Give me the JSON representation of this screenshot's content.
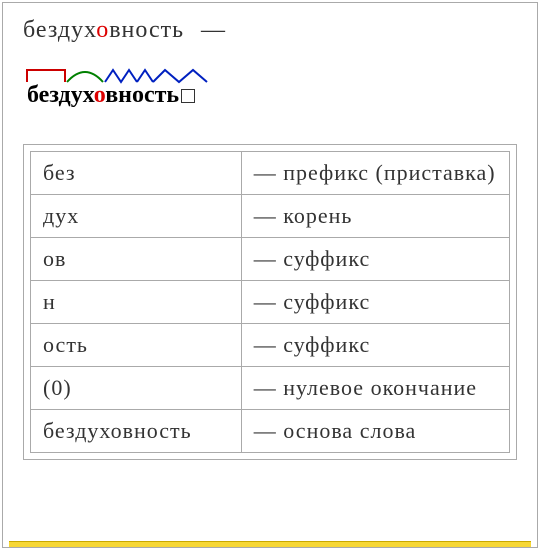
{
  "headword": {
    "pre": "бездух",
    "stress": "о",
    "post": "вность",
    "dash": "—"
  },
  "morph": {
    "pre": "бездух",
    "stress": "о",
    "post": "вность"
  },
  "rows": [
    {
      "part": "без",
      "def": "— префикс (приставка)"
    },
    {
      "part": "дух",
      "def": "— корень"
    },
    {
      "part": "ов",
      "def": "— суффикс"
    },
    {
      "part": "н",
      "def": "— суффикс"
    },
    {
      "part": "ость",
      "def": "— суффикс"
    },
    {
      "part": "(0)",
      "def": "— нулевое окончание"
    },
    {
      "part": "бездуховность",
      "def": "— основа слова"
    }
  ]
}
